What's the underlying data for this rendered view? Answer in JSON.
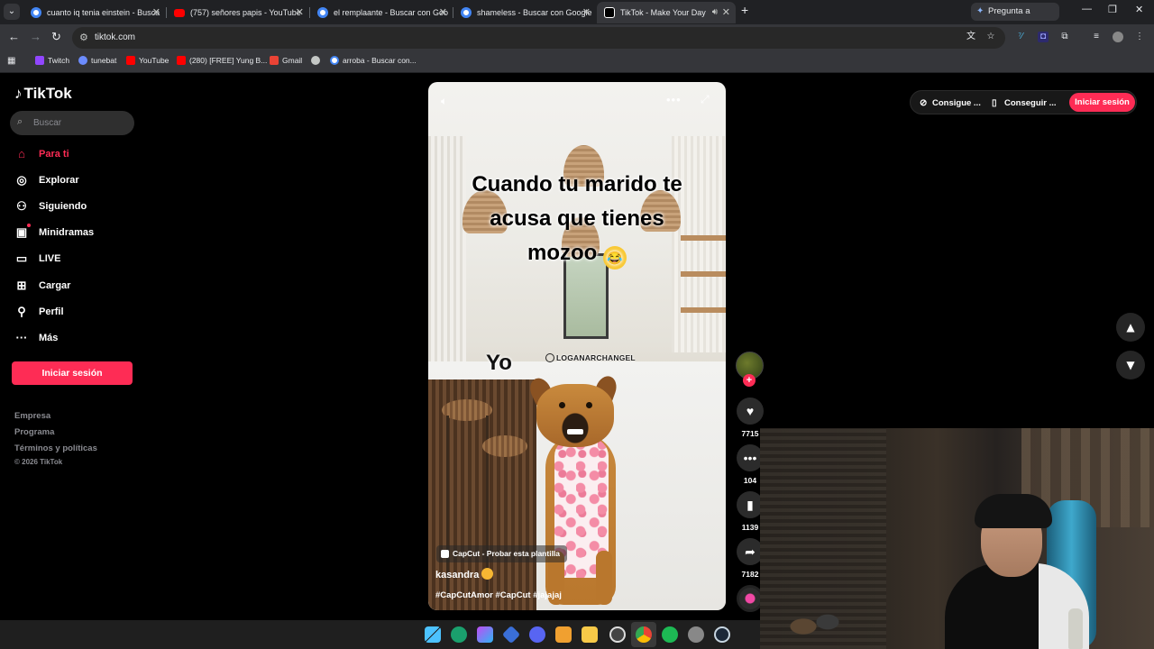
{
  "browser": {
    "tabs": [
      {
        "title": "cuanto iq tenia einstein - Busca",
        "favicon": "google-icon",
        "active": false
      },
      {
        "title": "(757) señores papis - YouTube",
        "favicon": "youtube-icon",
        "active": false
      },
      {
        "title": "el remplaante - Buscar con Goo",
        "favicon": "google-icon",
        "active": false
      },
      {
        "title": "shameless - Buscar con Google",
        "favicon": "google-icon",
        "active": false
      },
      {
        "title": "TikTok - Make Your Day",
        "favicon": "tiktok-icon",
        "active": true
      }
    ],
    "gemini_label": "Pregunta a Gemini",
    "url": "tiktok.com",
    "bookmarks": [
      {
        "label": "Twitch",
        "color": "#9146ff"
      },
      {
        "label": "tunebat",
        "color": "#6c8cff"
      },
      {
        "label": "YouTube",
        "color": "#ff0000"
      },
      {
        "label": "(280) [FREE] Yung B...",
        "color": "#ff0000"
      },
      {
        "label": "Gmail",
        "color": "#ea4335"
      },
      {
        "label": "",
        "color": "#c4c7c5"
      },
      {
        "label": "arroba - Buscar con...",
        "color": "#4285f4"
      }
    ]
  },
  "tiktok": {
    "logo": "TikTok",
    "search_placeholder": "Buscar",
    "nav": [
      {
        "label": "Para ti",
        "icon": "home-icon",
        "active": true
      },
      {
        "label": "Explorar",
        "icon": "compass-icon",
        "active": false
      },
      {
        "label": "Siguiendo",
        "icon": "following-icon",
        "active": false
      },
      {
        "label": "Minidramas",
        "icon": "film-icon",
        "active": false
      },
      {
        "label": "LIVE",
        "icon": "live-tv-icon",
        "active": false
      },
      {
        "label": "Cargar",
        "icon": "upload-plus-icon",
        "active": false
      },
      {
        "label": "Perfil",
        "icon": "person-icon",
        "active": false
      },
      {
        "label": "Más",
        "icon": "more-dots-icon",
        "active": false
      }
    ],
    "login_button": "Iniciar sesión",
    "footer_links": [
      "Empresa",
      "Programa",
      "Términos y políticas"
    ],
    "copyright": "© 2026 TikTok",
    "top_buttons": {
      "coins": "Consigue ...",
      "app": "Conseguir ...",
      "login": "Iniciar sesión"
    },
    "accent_color": "#fe2c55",
    "video": {
      "caption_lines": [
        "Cuando tu marido te",
        "acusa que tienes",
        "mozoo"
      ],
      "caption_emoji": "😂",
      "overlay_text": "Yo",
      "watermark": "LOGANARCHANGEL",
      "template_label": "CapCut - Probar esta plantilla",
      "author": "kasandra",
      "hashtags": "#CapCutAmor #CapCut #jajajaj"
    },
    "actions": {
      "likes": "7715",
      "comments": "104",
      "saves": "1139",
      "shares": "7182"
    }
  }
}
